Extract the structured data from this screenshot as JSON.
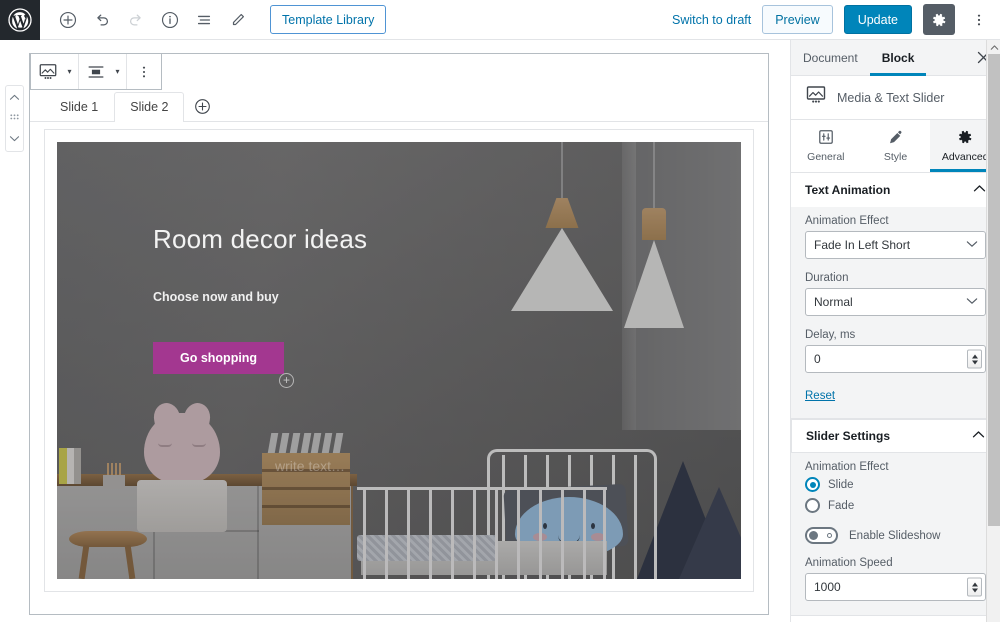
{
  "topbar": {
    "logo_icon": "wordpress-logo-icon",
    "tools": [
      {
        "name": "add-block-button",
        "icon": "plus-circle-icon",
        "label": "Add block",
        "disabled": false
      },
      {
        "name": "undo-button",
        "icon": "undo-arrow-icon",
        "label": "Undo",
        "disabled": false
      },
      {
        "name": "redo-button",
        "icon": "redo-arrow-icon",
        "label": "Redo",
        "disabled": true
      },
      {
        "name": "content-info-button",
        "icon": "info-circle-icon",
        "label": "Content structure",
        "disabled": false
      },
      {
        "name": "block-navigation-button",
        "icon": "list-view-icon",
        "label": "Block navigation",
        "disabled": false
      },
      {
        "name": "edit-mode-button",
        "icon": "pencil-icon",
        "label": "Edit",
        "disabled": false
      }
    ],
    "template_library_label": "Template Library",
    "switch_to_draft_label": "Switch to draft",
    "preview_label": "Preview",
    "update_label": "Update",
    "settings_icon": "gear-icon",
    "more_icon": "kebab-menu-icon"
  },
  "block_toolbar": {
    "block_type_icon": "media-text-slider-icon",
    "block_type_caret": "▾",
    "align_icon": "align-center-icon",
    "align_caret": "▾",
    "more_icon": "kebab-menu-icon"
  },
  "mover": {
    "up_icon": "chevron-up-icon",
    "drag_icon": "drag-handle-icon",
    "down_icon": "chevron-down-icon"
  },
  "slider": {
    "tabs": [
      {
        "label": "Slide 1",
        "active": false
      },
      {
        "label": "Slide 2",
        "active": true
      }
    ],
    "add_slide_icon": "plus-circle-icon",
    "slide": {
      "heading": "Room decor ideas",
      "subheading": "Choose now and buy",
      "button_label": "Go shopping",
      "button_color": "#a33790",
      "appender_icon": "plus-circle-icon",
      "placeholder_text": "write text…"
    }
  },
  "sidebar": {
    "tabs": [
      {
        "label": "Document",
        "active": false
      },
      {
        "label": "Block",
        "active": true
      }
    ],
    "close_icon": "close-icon",
    "block": {
      "icon": "media-text-slider-icon",
      "name": "Media & Text Slider"
    },
    "subtabs": [
      {
        "label": "General",
        "icon": "sliders-icon",
        "active": false
      },
      {
        "label": "Style",
        "icon": "brush-icon",
        "active": false
      },
      {
        "label": "Advanced",
        "icon": "gear-icon",
        "active": true
      }
    ],
    "text_animation": {
      "title": "Text Animation",
      "collapse_icon": "chevron-up-icon",
      "effect_label": "Animation Effect",
      "effect_value": "Fade In Left Short",
      "duration_label": "Duration",
      "duration_value": "Normal",
      "delay_label": "Delay, ms",
      "delay_value": "0",
      "reset_label": "Reset"
    },
    "slider_settings": {
      "title": "Slider Settings",
      "collapse_icon": "chevron-up-icon",
      "effect_label": "Animation Effect",
      "options": [
        {
          "label": "Slide",
          "selected": true
        },
        {
          "label": "Fade",
          "selected": false
        }
      ],
      "slideshow_label": "Enable Slideshow",
      "slideshow_on": false,
      "speed_label": "Animation Speed",
      "speed_value": "1000"
    }
  },
  "scrollbar": {
    "up_icon": "chevron-up-icon"
  },
  "colors": {
    "accent_blue": "#0085ba",
    "link_blue": "#0073aa",
    "dark_bar": "#23282d",
    "button_magenta": "#a33790",
    "panel_grey": "#f3f4f5",
    "border_grey": "#e2e4e7"
  }
}
